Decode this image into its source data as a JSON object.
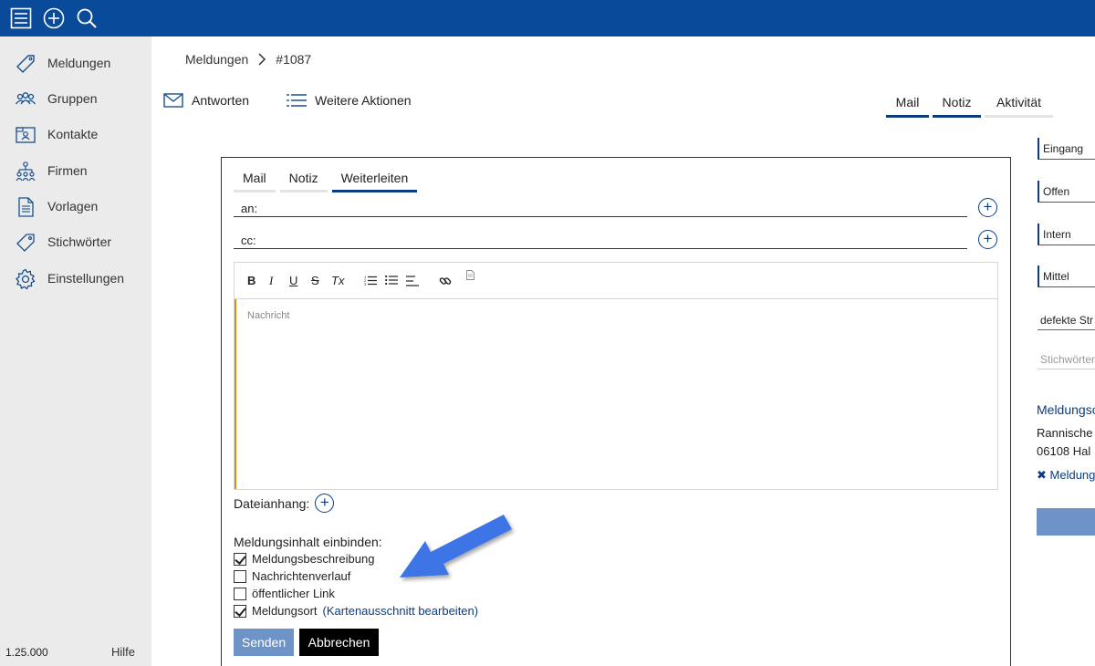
{
  "app": {
    "icons": [
      "menu-icon",
      "add-circle-icon",
      "search-icon"
    ],
    "colors": {
      "topbar": "#0a4a9b",
      "accent": "#0a3d82",
      "button_primary": "#6d93c7",
      "editor_marker": "#e38b12"
    }
  },
  "sidebar": {
    "items": [
      {
        "label": "Meldungen",
        "icon": "tag-icon"
      },
      {
        "label": "Gruppen",
        "icon": "group-icon"
      },
      {
        "label": "Kontakte",
        "icon": "contacts-icon"
      },
      {
        "label": "Firmen",
        "icon": "org-chart-icon"
      },
      {
        "label": "Vorlagen",
        "icon": "document-icon"
      },
      {
        "label": "Stichwörter",
        "icon": "label-icon"
      },
      {
        "label": "Einstellungen",
        "icon": "gear-icon"
      }
    ],
    "version": "1.25.000",
    "help": "Hilfe"
  },
  "breadcrumb": {
    "root": "Meldungen",
    "current": "#1087"
  },
  "actions": {
    "reply": "Antworten",
    "more": "Weitere Aktionen"
  },
  "top_tabs": [
    {
      "label": "Mail",
      "active": true
    },
    {
      "label": "Notiz",
      "active": true
    },
    {
      "label": "Aktivität",
      "active": false
    }
  ],
  "right_panel": {
    "fields": [
      "Eingang",
      "Offen",
      "Intern",
      "Mittel"
    ],
    "category": "defekte Str",
    "keywords_placeholder": "Stichwörter",
    "location_title": "Meldungso",
    "address_line1": "Rannische",
    "address_line2": "06108 Hal",
    "location_link": "Meldung"
  },
  "composer": {
    "tabs": [
      {
        "label": "Mail",
        "active": false
      },
      {
        "label": "Notiz",
        "active": false
      },
      {
        "label": "Weiterleiten",
        "active": true
      }
    ],
    "to_label": "an:",
    "cc_label": "cc:",
    "toolbar": {
      "bold": "B",
      "italic": "I",
      "underline": "U",
      "strike": "S",
      "clear": "Tx"
    },
    "message_placeholder": "Nachricht",
    "attachment_label": "Dateianhang:",
    "include_title": "Meldungsinhalt einbinden:",
    "include_options": [
      {
        "label": "Meldungsbeschreibung",
        "checked": true
      },
      {
        "label": "Nachrichtenverlauf",
        "checked": false
      },
      {
        "label": "öffentlicher Link",
        "checked": false
      },
      {
        "label": "Meldungsort",
        "checked": true,
        "link": "(Kartenausschnitt bearbeiten)"
      }
    ],
    "send": "Senden",
    "cancel": "Abbrechen"
  }
}
